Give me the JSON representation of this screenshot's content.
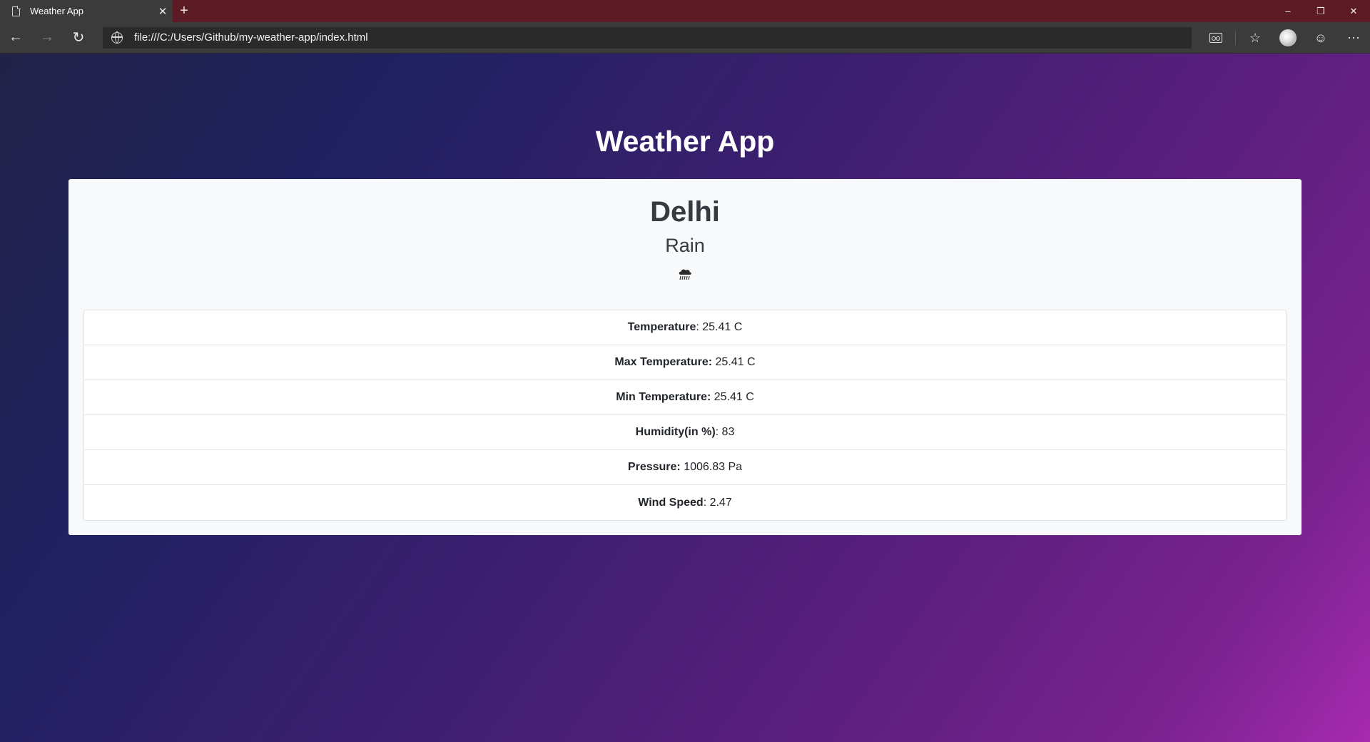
{
  "browser": {
    "tab_title": "Weather App",
    "url": "file:///C:/Users/Github/my-weather-app/index.html"
  },
  "page": {
    "title": "Weather App",
    "city": "Delhi",
    "condition": "Rain",
    "weather_icon": "rain-cloud-icon",
    "details": [
      {
        "label": "Temperature",
        "sep": ": ",
        "value": "25.41 C"
      },
      {
        "label": "Max Temperature:",
        "sep": " ",
        "value": "25.41 C"
      },
      {
        "label": "Min Temperature:",
        "sep": " ",
        "value": "25.41 C"
      },
      {
        "label": "Humidity(in %)",
        "sep": ": ",
        "value": "83"
      },
      {
        "label": "Pressure:",
        "sep": " ",
        "value": "1006.83 Pa"
      },
      {
        "label": "Wind Speed",
        "sep": ": ",
        "value": "2.47"
      }
    ]
  },
  "colors": {
    "tabbar": "#5b1a24",
    "chrome": "#3b3b3b",
    "card": "#f8f9fa",
    "text_dark": "#343a40"
  }
}
